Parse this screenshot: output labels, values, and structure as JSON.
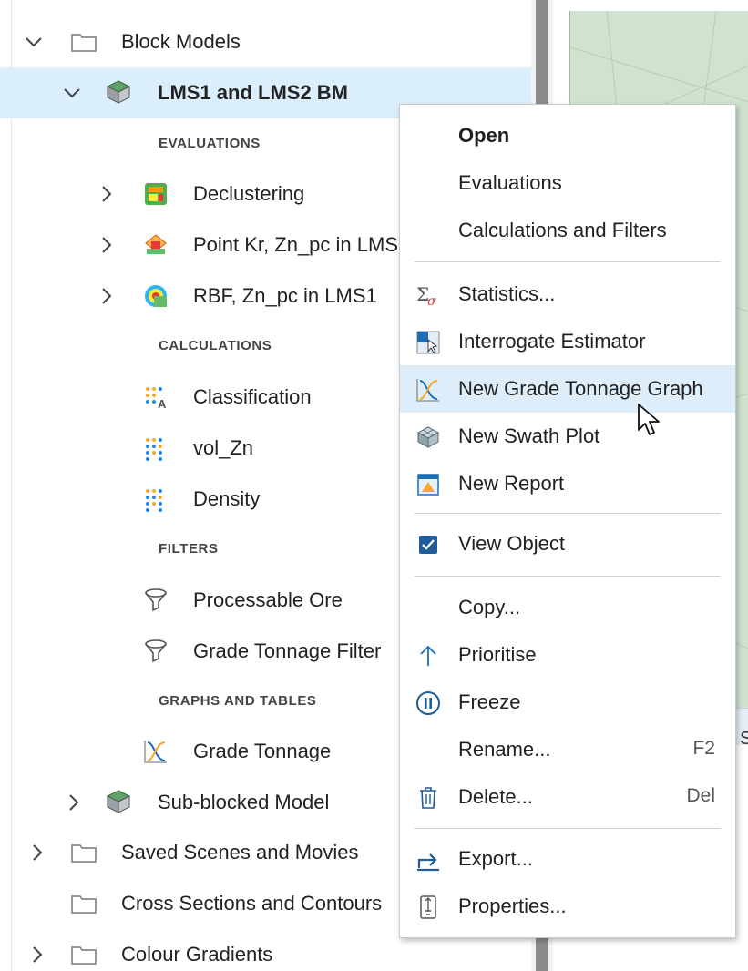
{
  "tree": {
    "block_models": "Block Models",
    "lms_bm": "LMS1 and LMS2 BM",
    "sec_evaluations": "EVALUATIONS",
    "declustering": "Declustering",
    "point_kr": "Point Kr, Zn_pc in LMS",
    "rbf": "RBF, Zn_pc in LMS1",
    "sec_calculations": "CALCULATIONS",
    "classification": "Classification",
    "vol_zn": "vol_Zn",
    "density": "Density",
    "sec_filters": "FILTERS",
    "processable_ore": "Processable Ore",
    "grade_tonnage_filter": "Grade Tonnage Filter",
    "sec_graphs": "GRAPHS AND TABLES",
    "grade_tonnage": "Grade Tonnage",
    "sub_blocked": "Sub-blocked Model",
    "saved_scenes": "Saved Scenes and Movies",
    "cross_sections": "Cross Sections and Contours",
    "colour_gradients": "Colour Gradients"
  },
  "menu": {
    "open": "Open",
    "evaluations": "Evaluations",
    "calculations_filters": "Calculations and Filters",
    "statistics": "Statistics...",
    "interrogate": "Interrogate Estimator",
    "new_gt_graph": "New Grade Tonnage Graph",
    "new_swath": "New Swath Plot",
    "new_report": "New Report",
    "view_object": "View Object",
    "copy": "Copy...",
    "prioritise": "Prioritise",
    "freeze": "Freeze",
    "rename": "Rename...",
    "rename_shortcut": "F2",
    "delete": "Delete...",
    "delete_shortcut": "Del",
    "export": "Export...",
    "properties": "Properties..."
  },
  "scene": {
    "edge_text": "S"
  },
  "colors": {
    "selection": "#dbeefb",
    "menu_highlight": "#ddeefa",
    "accent": "#1f6db5"
  },
  "icons": {
    "folder": "folder-icon",
    "block_model": "block-model-icon",
    "declustering": "declustering-icon",
    "kriging": "kriging-icon",
    "rbf": "rbf-icon",
    "calculation": "calculation-icon",
    "filter": "filter-icon",
    "grade_tonnage": "grade-tonnage-icon",
    "statistics": "statistics-icon",
    "interrogate": "interrogate-icon",
    "swath": "swath-icon",
    "report": "report-icon",
    "checkbox": "checkbox-checked-icon",
    "prioritise": "arrow-up-icon",
    "freeze": "pause-icon",
    "delete": "trash-icon",
    "export": "export-icon",
    "properties": "properties-icon",
    "cursor": "mouse-cursor-icon"
  }
}
